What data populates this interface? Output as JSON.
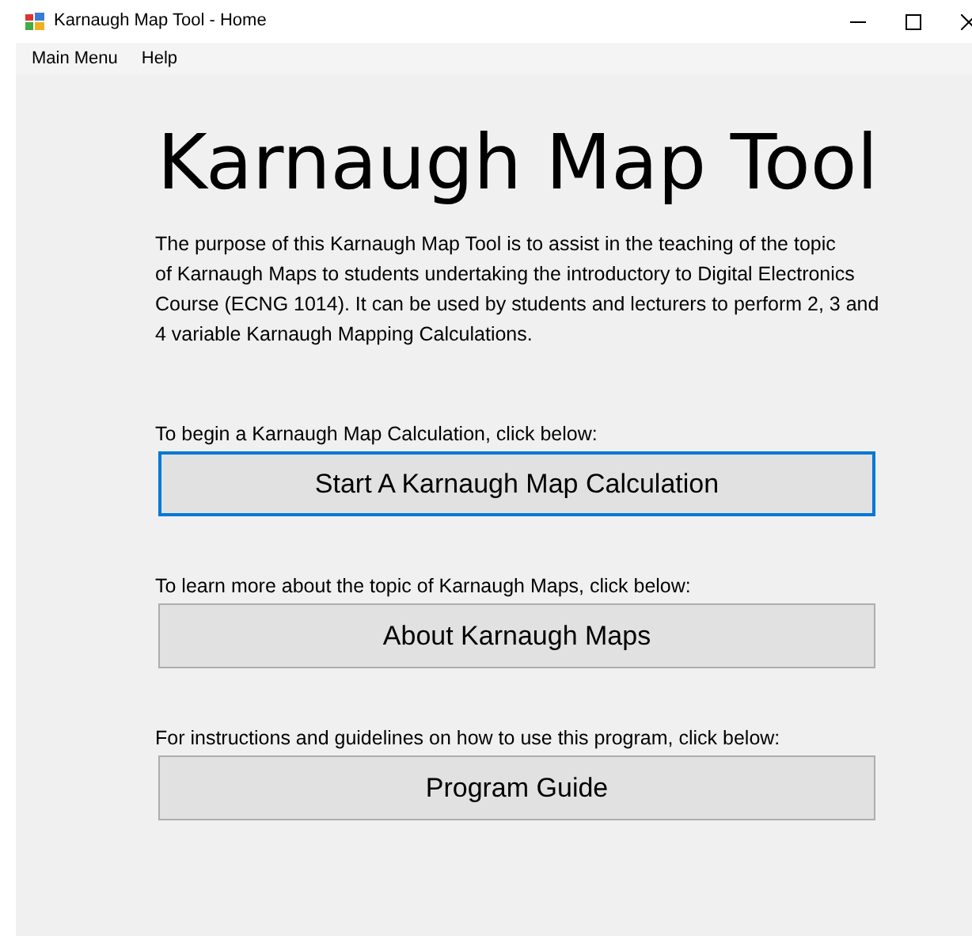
{
  "window": {
    "title": "Karnaugh Map Tool - Home"
  },
  "menu": [
    "Main Menu",
    "Help"
  ],
  "heading": "Karnaugh Map Tool",
  "description": [
    "The purpose of this Karnaugh Map Tool is to assist in the teaching of the topic",
    "of Karnaugh Maps to students undertaking the introductory to Digital Electronics",
    "Course (ECNG 1014). It can be used by students and lecturers to perform 2, 3 and",
    "4 variable Karnaugh Mapping Calculations."
  ],
  "sections": [
    {
      "label": "To begin a Karnaugh Map Calculation, click below:",
      "button": "Start A Karnaugh Map Calculation",
      "focused": true
    },
    {
      "label": "To learn more about the topic of Karnaugh Maps, click below:",
      "button": "About Karnaugh Maps",
      "focused": false
    },
    {
      "label": "For instructions and guidelines on how to use this program, click below:",
      "button": "Program Guide",
      "focused": false
    }
  ]
}
